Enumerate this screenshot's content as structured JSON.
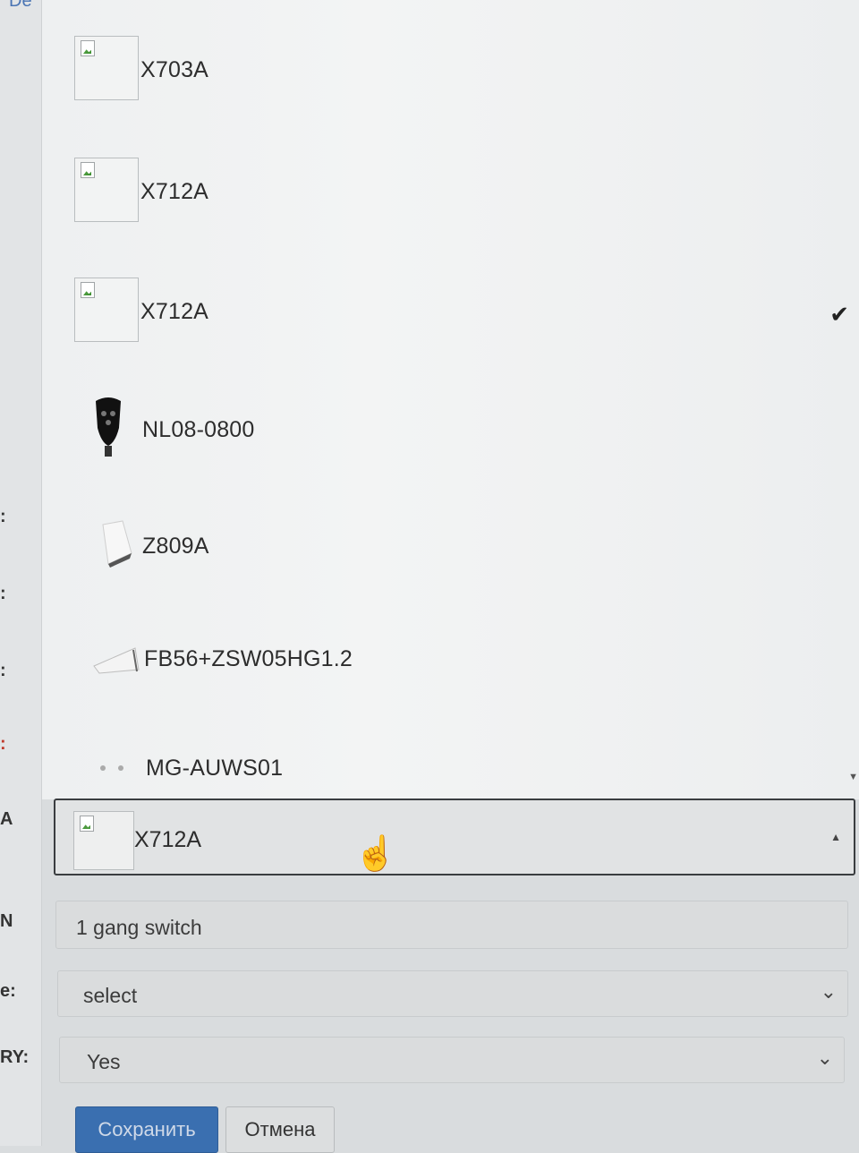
{
  "left_labels": {
    "top_cut": "De",
    "label_a": "A",
    "label_n": "N",
    "label_e": "e:",
    "label_ry": "RY:"
  },
  "dropdown": {
    "options": [
      {
        "label": "X703A",
        "icon": "broken-image-icon"
      },
      {
        "label": "X712A",
        "icon": "broken-image-icon"
      },
      {
        "label": "X712A",
        "icon": "broken-image-icon",
        "selected": true
      },
      {
        "label": "NL08-0800",
        "icon": "plug-device-icon"
      },
      {
        "label": "Z809A",
        "icon": "sensor-device-icon"
      },
      {
        "label": "FB56+ZSW05HG1.2",
        "icon": "switch-device-icon"
      },
      {
        "label": "MG-AUWS01",
        "icon": "wall-switch-icon"
      }
    ],
    "check_glyph": "✔"
  },
  "select_open": {
    "value": "X712A",
    "caret": "▲"
  },
  "name_field": {
    "value": "1 gang switch"
  },
  "type_select": {
    "value": "select",
    "chevron": "⌄"
  },
  "ry_select": {
    "value": "Yes",
    "chevron": "⌄"
  },
  "buttons": {
    "save": "Сохранить",
    "cancel": "Отмена"
  },
  "colors": {
    "primary_button": "#3a6fb0",
    "background": "#d9dcde"
  }
}
